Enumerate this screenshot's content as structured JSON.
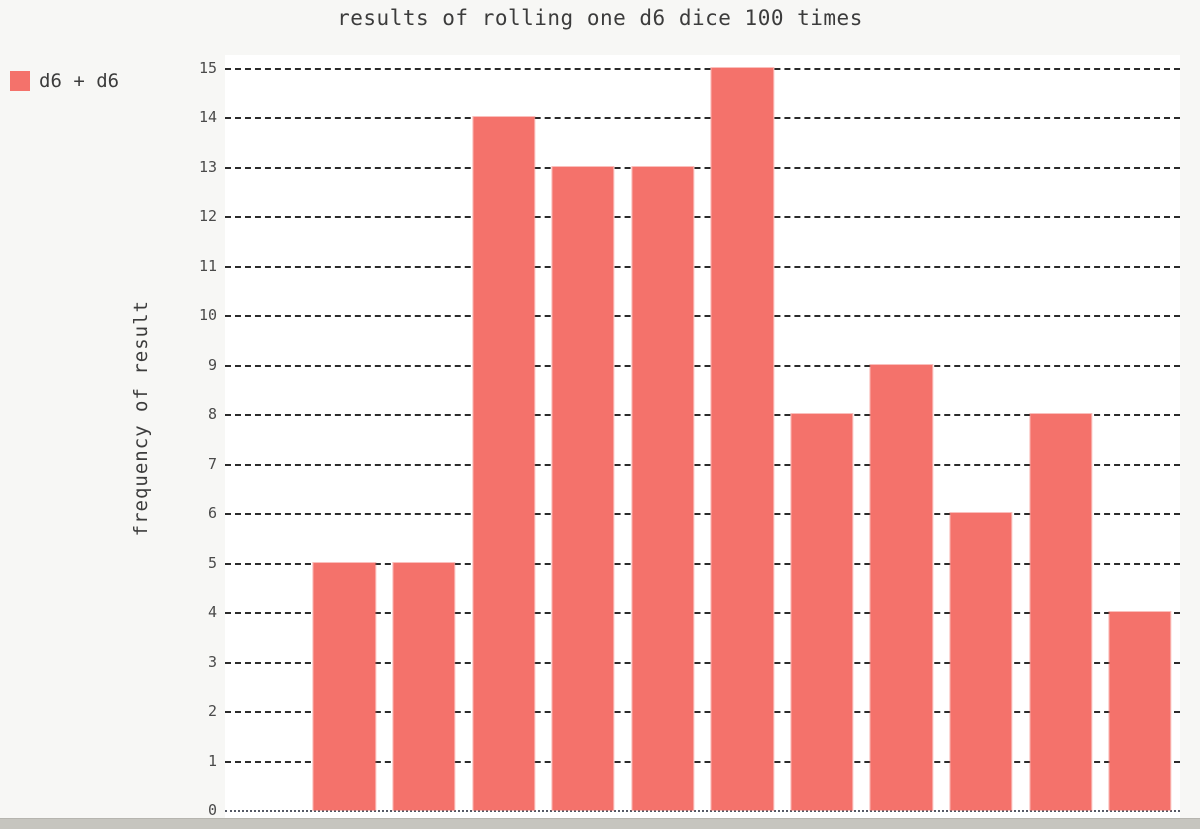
{
  "chart_data": {
    "type": "bar",
    "title": "results of rolling one d6 dice 100 times",
    "xlabel": "",
    "ylabel": "frequency of result",
    "ylim": [
      0,
      15
    ],
    "grid": true,
    "legend_position": "top-left",
    "bar_color": "#f4726b",
    "plot_background": "#ffffff",
    "page_background": "#f7f7f5",
    "gridline_color": "#2b2b2b",
    "gridline_style": "dashed",
    "series": [
      {
        "name": "d6 + d6",
        "values": [
          0,
          5,
          5,
          14,
          13,
          13,
          15,
          8,
          9,
          6,
          8,
          4
        ]
      }
    ],
    "categories": [
      "",
      "",
      "",
      "",
      "",
      "",
      "",
      "",
      "",
      "",
      "",
      ""
    ],
    "ytick_labels": [
      "15",
      "14",
      "13",
      "12",
      "11",
      "10",
      "9",
      "8",
      "7",
      "6",
      "5",
      "4",
      "3",
      "2",
      "1",
      "0"
    ],
    "ytick_values": [
      15,
      14,
      13,
      12,
      11,
      10,
      9,
      8,
      7,
      6,
      5,
      4,
      3,
      2,
      1,
      0
    ]
  },
  "legend": {
    "entries": [
      {
        "label": "d6 + d6",
        "color": "#f4726b"
      }
    ]
  },
  "axes": {
    "y_title": "frequency of result"
  }
}
